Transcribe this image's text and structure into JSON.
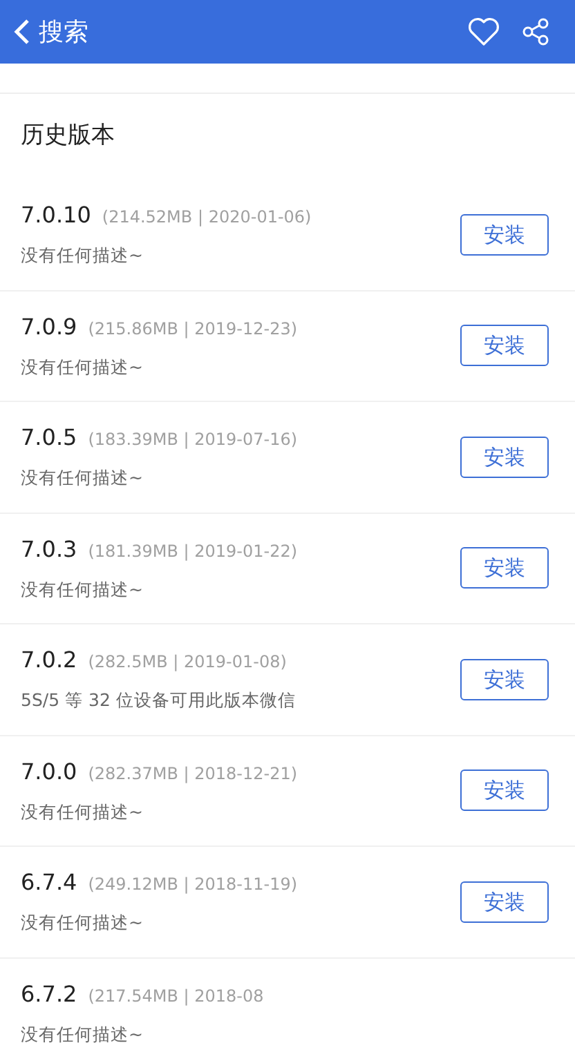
{
  "header": {
    "back_label": "搜索"
  },
  "section_title": "历史版本",
  "versions": [
    {
      "version": "7.0.10",
      "meta": "(214.52MB | 2020-01-06)",
      "description": "没有任何描述~",
      "button": "安装"
    },
    {
      "version": "7.0.9",
      "meta": "(215.86MB | 2019-12-23)",
      "description": "没有任何描述~",
      "button": "安装"
    },
    {
      "version": "7.0.5",
      "meta": "(183.39MB | 2019-07-16)",
      "description": "没有任何描述~",
      "button": "安装"
    },
    {
      "version": "7.0.3",
      "meta": "(181.39MB | 2019-01-22)",
      "description": "没有任何描述~",
      "button": "安装"
    },
    {
      "version": "7.0.2",
      "meta": "(282.5MB | 2019-01-08)",
      "description": "5S/5 等 32 位设备可用此版本微信",
      "button": "安装"
    },
    {
      "version": "7.0.0",
      "meta": "(282.37MB | 2018-12-21)",
      "description": "没有任何描述~",
      "button": "安装"
    },
    {
      "version": "6.7.4",
      "meta": "(249.12MB | 2018-11-19)",
      "description": "没有任何描述~",
      "button": "安装"
    },
    {
      "version": "6.7.2",
      "meta": "(217.54MB | 2018-08",
      "description": "没有任何描述~"
    }
  ]
}
